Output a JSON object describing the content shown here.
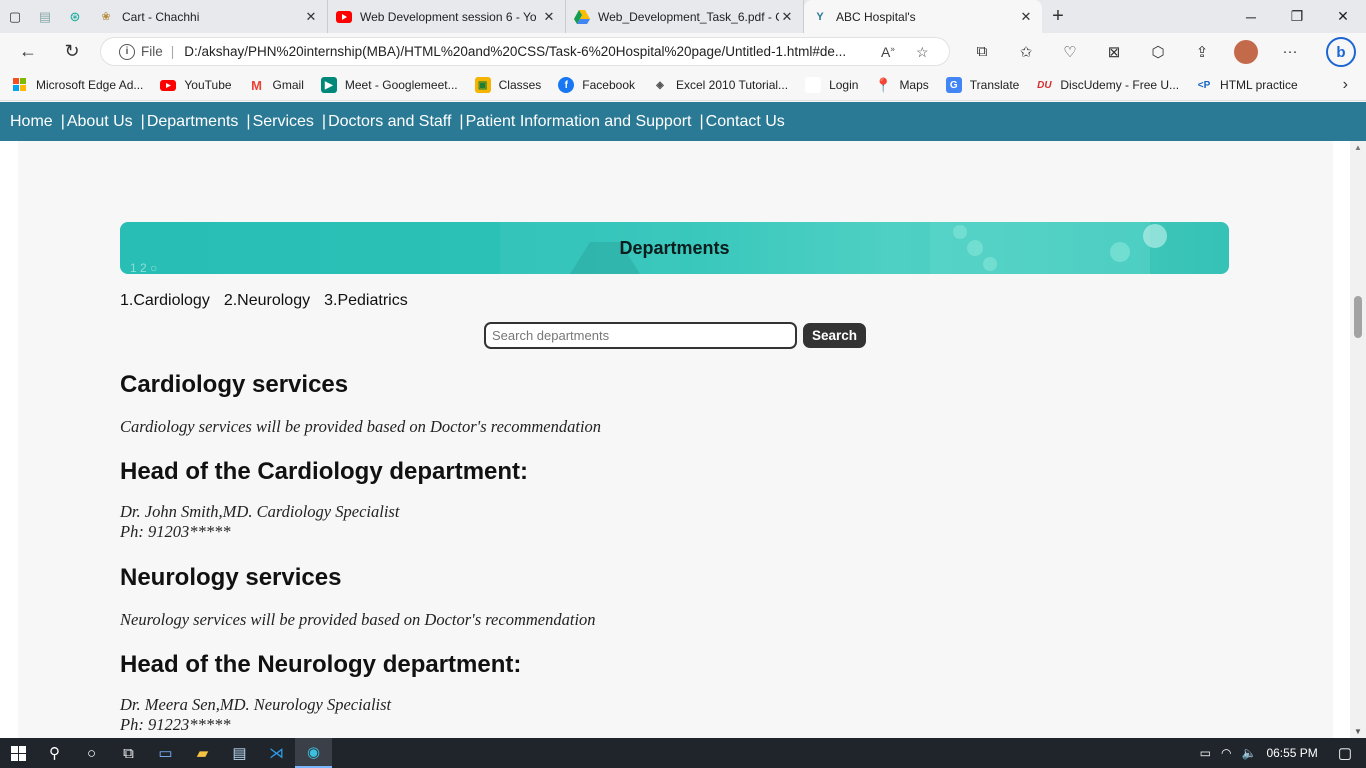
{
  "browser": {
    "tabs": [
      {
        "title": "Cart - Chachhi",
        "icon": "cart-favicon"
      },
      {
        "title": "Web Development session 6 - Yo",
        "icon": "youtube-favicon"
      },
      {
        "title": "Web_Development_Task_6.pdf - G",
        "icon": "google-drive-favicon"
      },
      {
        "title": "ABC Hospital's",
        "icon": "hospital-favicon",
        "active": true
      }
    ],
    "address": {
      "label": "File",
      "url": "D:/akshay/PHN%20internship(MBA)/HTML%20and%20CSS/Task-6%20Hospital%20page/Untitled-1.html#de..."
    },
    "bookmarks": [
      {
        "label": "Microsoft Edge Ad...",
        "color": "#e74c3c"
      },
      {
        "label": "YouTube",
        "color": "#ff0000"
      },
      {
        "label": "Gmail",
        "color": "#ea4335"
      },
      {
        "label": "Meet - Googlemeet...",
        "color": "#00897b"
      },
      {
        "label": "Classes",
        "color": "#f4b400"
      },
      {
        "label": "Facebook",
        "color": "#1877f2"
      },
      {
        "label": "Excel 2010 Tutorial...",
        "color": "#555555"
      },
      {
        "label": "Login",
        "color": "#ffffff"
      },
      {
        "label": "Maps",
        "color": "#34a853"
      },
      {
        "label": "Translate",
        "color": "#4285f4"
      },
      {
        "label": "DiscUdemy - Free U...",
        "color": "#d32f2f"
      },
      {
        "label": "HTML practice",
        "color": "#1565c0"
      }
    ]
  },
  "site": {
    "nav": [
      "Home",
      "About Us",
      "Departments",
      "Services",
      "Doctors and Staff",
      "Patient Information and Support",
      "Contact Us"
    ],
    "banner_title": "Departments",
    "dept_list": [
      "1.Cardiology",
      "2.Neurology",
      "3.Pediatrics"
    ],
    "search": {
      "placeholder": "Search departments",
      "button": "Search"
    },
    "sections": [
      {
        "heading": "Cardiology services",
        "text": [
          "Cardiology services will be provided based on Doctor's recommendation"
        ]
      },
      {
        "heading": "Head of the Cardiology department:",
        "text": [
          "Dr. John Smith,MD. Cardiology Specialist",
          "Ph: 91203*****"
        ]
      },
      {
        "heading": "Neurology services",
        "text": [
          "Neurology services will be provided based on Doctor's recommendation"
        ]
      },
      {
        "heading": "Head of the Neurology department:",
        "text": [
          "Dr. Meera Sen,MD. Neurology Specialist",
          "Ph: 91223*****"
        ]
      }
    ]
  },
  "taskbar": {
    "time": "06:55 PM"
  }
}
